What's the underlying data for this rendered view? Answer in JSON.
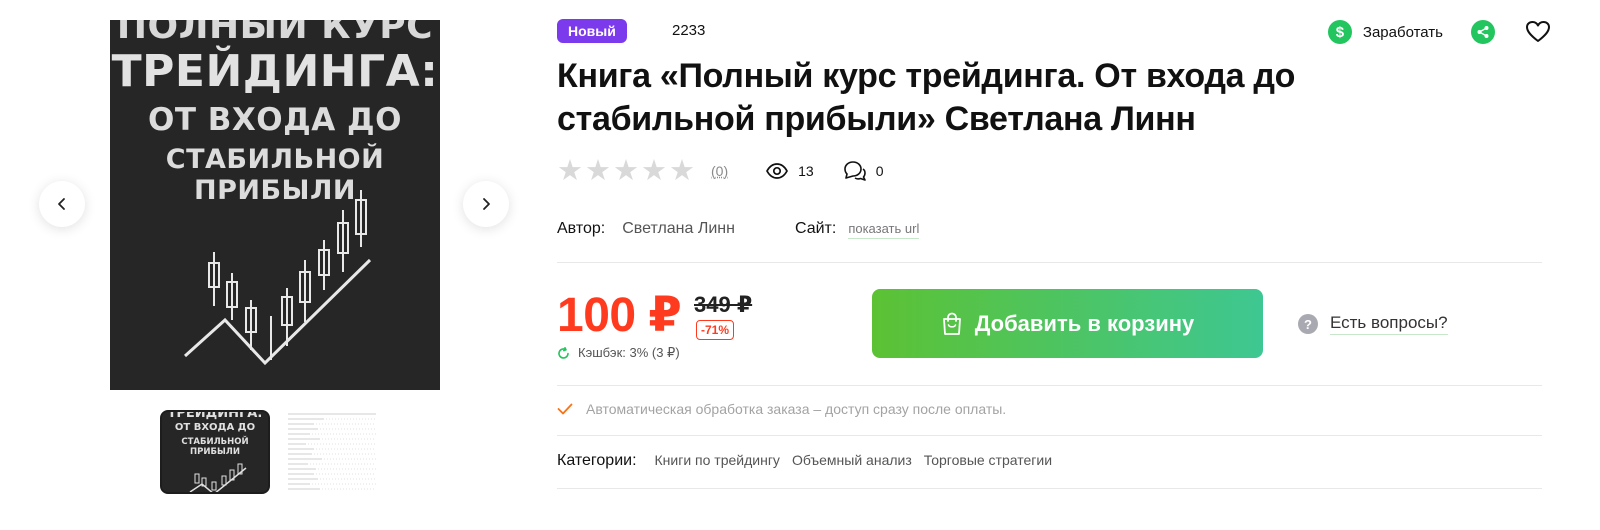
{
  "cover": {
    "line1": "ПОЛНЫЙ КУРС",
    "line2": "ТРЕЙДИНГА:",
    "line3": "ОТ ВХОДА ДО",
    "line4": "СТАБИЛЬНОЙ ПРИБЫЛИ"
  },
  "thumbs": [
    {
      "line1": "ТРЕЙДИНГА:",
      "line2": "ОТ ВХОДА ДО",
      "line3": "СТАБИЛЬНОЙ ПРИБЫЛИ"
    }
  ],
  "product": {
    "badge": "Новый",
    "sku": "2233",
    "title": "Книга «Полный курс трейдинга. От входа до стабильной прибыли» Светлана Линн",
    "rating_count": "(0)",
    "views": "13",
    "comments": "0",
    "author_label": "Автор:",
    "author": "Светлана Линн",
    "site_label": "Сайт:",
    "site_link": "показать url"
  },
  "actions": {
    "earn_icon": "$",
    "earn": "Заработать"
  },
  "pricing": {
    "current": "100 ₽",
    "old": "349 ₽",
    "discount": "-71%",
    "cashback": "Кэшбэк: 3% (3 ₽)"
  },
  "cart": {
    "label": "Добавить в корзину"
  },
  "questions": {
    "icon": "?",
    "label": "Есть вопросы?"
  },
  "auto_processing": "Автоматическая обработка заказа – доступ сразу после оплаты.",
  "categories": {
    "label": "Категории:",
    "items": [
      "Книги по трейдингу",
      "Объемный анализ",
      "Торговые стратегии"
    ]
  },
  "colors": {
    "badge": "#7c3aed",
    "price": "#ff3b1f",
    "cart_gradient_start": "#5cc234",
    "cart_gradient_end": "#3ec792",
    "earn": "#22c55e"
  },
  "icons": [
    "chevron-left-icon",
    "chevron-right-icon",
    "dollar-icon",
    "share-icon",
    "heart-icon",
    "star-icon",
    "eye-icon",
    "comment-icon",
    "refresh-icon",
    "shopping-bag-icon",
    "question-icon",
    "check-icon"
  ]
}
